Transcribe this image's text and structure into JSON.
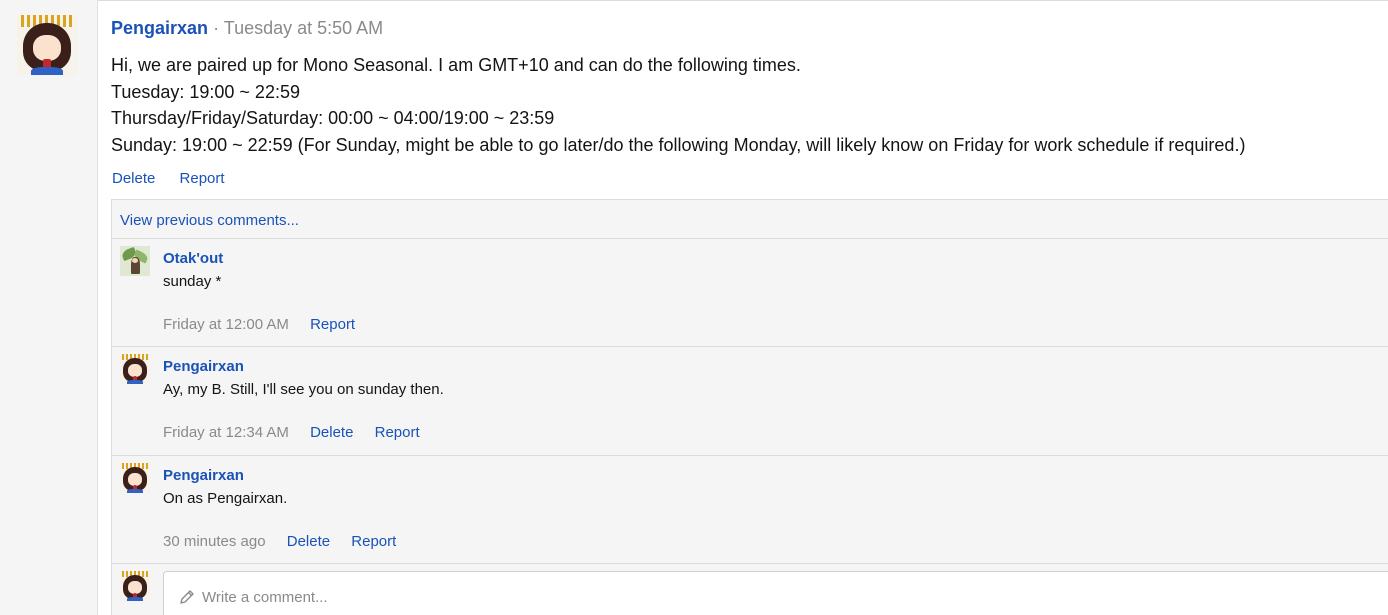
{
  "post": {
    "author": "Pengairxan",
    "separator": "·",
    "time": "Tuesday at 5:50 AM",
    "lines": [
      "Hi, we are paired up for Mono Seasonal. I am GMT+10 and can do the following times.",
      "Tuesday: 19:00 ~ 22:59",
      "Thursday/Friday/Saturday: 00:00 ~ 04:00/19:00 ~ 23:59",
      "Sunday: 19:00 ~ 22:59 (For Sunday, might be able to go later/do the following Monday, will likely know on Friday for work schedule if required.)"
    ],
    "actions": {
      "delete": "Delete",
      "report": "Report"
    }
  },
  "comments": {
    "view_previous": "View previous comments...",
    "items": [
      {
        "author": "Otak'out",
        "text": "sunday *",
        "time": "Friday at 12:00 AM",
        "report": "Report"
      },
      {
        "author": "Pengairxan",
        "text": "Ay, my B. Still, I'll see you on sunday then.",
        "time": "Friday at 12:34 AM",
        "delete": "Delete",
        "report": "Report"
      },
      {
        "author": "Pengairxan",
        "text": "On as Pengairxan.",
        "time": "30 minutes ago",
        "delete": "Delete",
        "report": "Report"
      }
    ],
    "write_placeholder": "Write a comment..."
  },
  "icons": {
    "pencil": "pencil-icon"
  },
  "colors": {
    "link": "#1a52b8",
    "muted": "#8a8a8a",
    "panel_bg": "#f5f5f5"
  }
}
